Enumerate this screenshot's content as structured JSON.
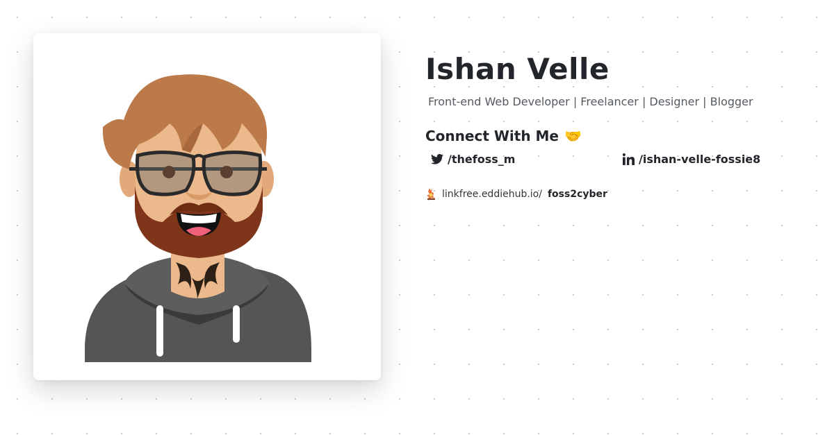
{
  "profile": {
    "name": "Ishan Velle",
    "tagline": "Front-end Web Developer | Freelancer | Designer | Blogger"
  },
  "connect": {
    "heading": "Connect With Me",
    "heading_emoji": "🤝"
  },
  "socials": {
    "twitter": {
      "handle": "/thefoss_m",
      "icon": "twitter-icon"
    },
    "linkedin": {
      "handle": "/ishan-velle-fossie8",
      "icon": "linkedin-icon"
    }
  },
  "linkfree": {
    "prefix": "linkfree.eddiehub.io/",
    "username": "foss2cyber",
    "icon": "linkfree-icon"
  },
  "colors": {
    "text": "#22252a",
    "hair": "#bc7a4a",
    "beard": "#7e3519",
    "skin": "#ebb98b",
    "hoodie": "#555555"
  }
}
